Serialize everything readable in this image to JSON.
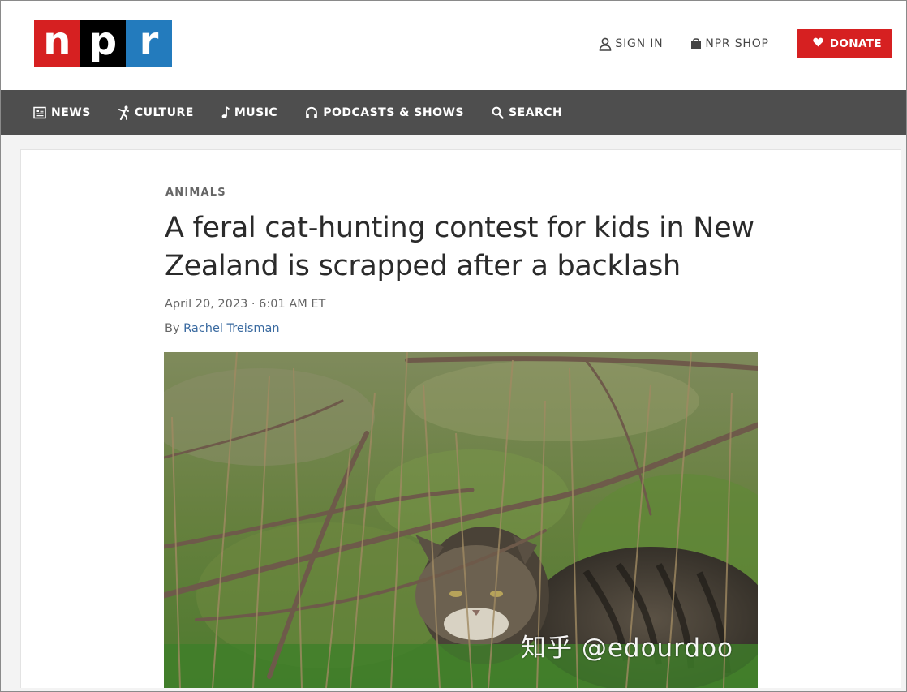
{
  "brand": {
    "logo_letters": [
      "n",
      "p",
      "r"
    ],
    "logo_colors": [
      "#d62021",
      "#000000",
      "#237bbd"
    ]
  },
  "header": {
    "sign_in": {
      "label": "SIGN IN",
      "icon": "user-icon"
    },
    "shop": {
      "label": "NPR SHOP",
      "icon": "bag-icon"
    },
    "donate": {
      "label": "DONATE",
      "icon": "heart-icon",
      "color": "#d62021"
    }
  },
  "nav": {
    "items": [
      {
        "label": "NEWS",
        "icon": "news-icon"
      },
      {
        "label": "CULTURE",
        "icon": "culture-icon"
      },
      {
        "label": "MUSIC",
        "icon": "music-note-icon"
      },
      {
        "label": "PODCASTS & SHOWS",
        "icon": "headphones-icon"
      },
      {
        "label": "SEARCH",
        "icon": "search-icon"
      }
    ],
    "background": "#4e4e4e"
  },
  "article": {
    "slug": "ANIMALS",
    "headline": "A feral cat-hunting contest for kids in New Zealand is scrapped after a backlash",
    "date": "April 20, 2023 · 6:01 AM ET",
    "byline_prefix": "By ",
    "author": "Rachel Treisman"
  },
  "watermark": {
    "text": "知乎 @edourdoo"
  }
}
